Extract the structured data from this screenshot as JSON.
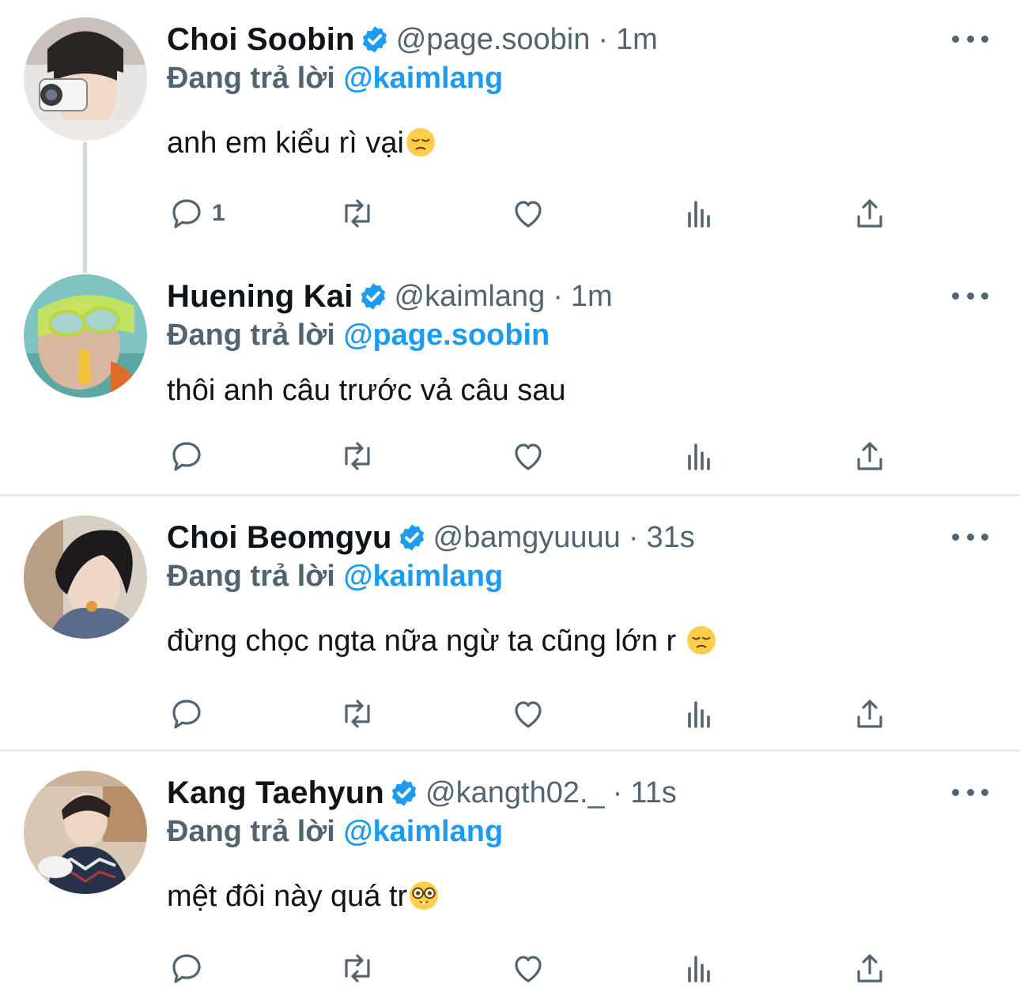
{
  "colors": {
    "text": "#0f1419",
    "secondary": "#536471",
    "accent": "#1d9bf0",
    "divider": "#e7e9ea",
    "thread_line": "#cfd9de"
  },
  "reply_label": "Đang trả lời",
  "tweets": [
    {
      "name": "Choi Soobin",
      "handle": "@page.soobin",
      "separator": "·",
      "time": "1m",
      "reply_to": "@kaimlang",
      "text": "anh em kiểu rì vại",
      "emoji": "pensive-face",
      "reply_count": "1",
      "verified": true
    },
    {
      "name": "Huening Kai",
      "handle": "@kaimlang",
      "separator": "·",
      "time": "1m",
      "reply_to": "@page.soobin",
      "text": "thôi anh câu trước vả câu sau",
      "emoji": "",
      "reply_count": "",
      "verified": true
    },
    {
      "name": "Choi Beomgyu",
      "handle": "@bamgyuuuu",
      "separator": "·",
      "time": "31s",
      "reply_to": "@kaimlang",
      "text": "đừng chọc ngta nữa ngừ ta cũng lớn r ",
      "emoji": "pensive-face",
      "reply_count": "",
      "verified": true
    },
    {
      "name": "Kang Taehyun",
      "handle": "@kangth02._",
      "separator": "·",
      "time": "11s",
      "reply_to": "@kaimlang",
      "text": "mệt đôi này quá tr",
      "emoji": "nerd-face",
      "reply_count": "",
      "verified": true
    }
  ]
}
